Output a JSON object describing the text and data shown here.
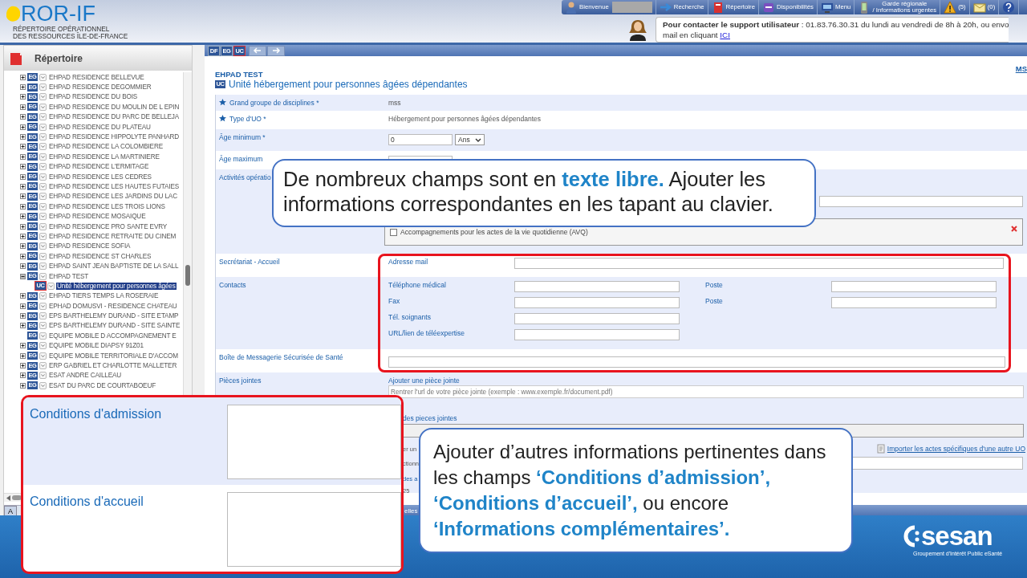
{
  "header": {
    "logo": "ROR-IF",
    "subtitle": [
      "RÉPERTOIRE OPÉRATIONNEL",
      "DES RESSOURCES ÎLE-DE-FRANCE"
    ]
  },
  "nav": [
    {
      "kind": "welcome",
      "lines": [
        "Bienvenue"
      ]
    },
    {
      "kind": "search",
      "lines": [
        "Recherche"
      ]
    },
    {
      "kind": "directory",
      "lines": [
        "Répertoire"
      ]
    },
    {
      "kind": "availability",
      "lines": [
        "Disponibilités"
      ]
    },
    {
      "kind": "menu",
      "lines": [
        "Menu"
      ]
    },
    {
      "kind": "guard",
      "lines": [
        "Garde régionale",
        "/ Informations urgentes"
      ]
    },
    {
      "kind": "alerts",
      "lines": [
        "(5)"
      ]
    },
    {
      "kind": "messages",
      "lines": [
        "(0)"
      ]
    },
    {
      "kind": "help"
    }
  ],
  "support": {
    "title": "Pour contacter le support utilisateur",
    "text": " : 01.83.76.30.31 du lundi au vendredi de 8h à 20h, ou envo",
    "text2": "mail en cliquant ",
    "link": "ICI"
  },
  "sidebar": {
    "title": "Répertoire",
    "tree": [
      {
        "label": "EHPAD RESIDENCE BELLEVUE",
        "badge": "EG",
        "expandable": true,
        "expanded": false,
        "selected": false
      },
      {
        "label": "EHPAD RESIDENCE DEGOMMIER",
        "badge": "EG",
        "expandable": true,
        "expanded": false,
        "selected": false
      },
      {
        "label": "EHPAD RESIDENCE DU BOIS",
        "badge": "EG",
        "expandable": true,
        "expanded": false,
        "selected": false
      },
      {
        "label": "EHPAD RESIDENCE DU MOULIN DE L EPIN",
        "badge": "EG",
        "expandable": true,
        "expanded": false,
        "selected": false
      },
      {
        "label": "EHPAD RESIDENCE DU PARC DE BELLEJA",
        "badge": "EG",
        "expandable": true,
        "expanded": false,
        "selected": false
      },
      {
        "label": "EHPAD RESIDENCE DU PLATEAU",
        "badge": "EG",
        "expandable": true,
        "expanded": false,
        "selected": false
      },
      {
        "label": "EHPAD RESIDENCE HIPPOLYTE PANHARD",
        "badge": "EG",
        "expandable": true,
        "expanded": false,
        "selected": false
      },
      {
        "label": "EHPAD RESIDENCE LA COLOMBIERE",
        "badge": "EG",
        "expandable": true,
        "expanded": false,
        "selected": false
      },
      {
        "label": "EHPAD RESIDENCE LA MARTINIERE",
        "badge": "EG",
        "expandable": true,
        "expanded": false,
        "selected": false
      },
      {
        "label": "EHPAD RESIDENCE L'ERMITAGE",
        "badge": "EG",
        "expandable": true,
        "expanded": false,
        "selected": false
      },
      {
        "label": "EHPAD RESIDENCE LES CEDRES",
        "badge": "EG",
        "expandable": true,
        "expanded": false,
        "selected": false
      },
      {
        "label": "EHPAD RESIDENCE LES HAUTES FUTAIES",
        "badge": "EG",
        "expandable": true,
        "expanded": false,
        "selected": false
      },
      {
        "label": "EHPAD RESIDENCE LES JARDINS DU LAC",
        "badge": "EG",
        "expandable": true,
        "expanded": false,
        "selected": false
      },
      {
        "label": "EHPAD RESIDENCE LES TROIS LIONS",
        "badge": "EG",
        "expandable": true,
        "expanded": false,
        "selected": false
      },
      {
        "label": "EHPAD RESIDENCE MOSAIQUE",
        "badge": "EG",
        "expandable": true,
        "expanded": false,
        "selected": false
      },
      {
        "label": "EHPAD RESIDENCE PRO SANTE EVRY",
        "badge": "EG",
        "expandable": true,
        "expanded": false,
        "selected": false
      },
      {
        "label": "EHPAD RESIDENCE RETRAITE DU CINEM",
        "badge": "EG",
        "expandable": true,
        "expanded": false,
        "selected": false
      },
      {
        "label": "EHPAD RESIDENCE SOFIA",
        "badge": "EG",
        "expandable": true,
        "expanded": false,
        "selected": false
      },
      {
        "label": "EHPAD RESIDENCE ST CHARLES",
        "badge": "EG",
        "expandable": true,
        "expanded": false,
        "selected": false
      },
      {
        "label": "EHPAD SAINT JEAN BAPTISTE DE LA SALL",
        "badge": "EG",
        "expandable": true,
        "expanded": false,
        "selected": false
      },
      {
        "label": "EHPAD TEST",
        "badge": "EG",
        "expandable": true,
        "expanded": true,
        "selected": false,
        "children": [
          {
            "label": "Unité hébergement pour personnes âgées",
            "badge": "UC",
            "expandable": false,
            "selected": true
          }
        ]
      },
      {
        "label": "EHPAD TIERS TEMPS LA ROSERAIE",
        "badge": "EG",
        "expandable": true,
        "expanded": false,
        "selected": false
      },
      {
        "label": "EPHAD DOMUSVI - RESIDENCE CHATEAU",
        "badge": "EG",
        "expandable": true,
        "expanded": false,
        "selected": false
      },
      {
        "label": "EPS BARTHELEMY DURAND - SITE ETAMP",
        "badge": "EG",
        "expandable": true,
        "expanded": false,
        "selected": false
      },
      {
        "label": "EPS BARTHELEMY DURAND - SITE SAINTE",
        "badge": "EG",
        "expandable": true,
        "expanded": false,
        "selected": false
      },
      {
        "label": "EQUIPE MOBILE D ACCOMPAGNEMENT E",
        "badge": "EG",
        "expandable": false,
        "selected": false
      },
      {
        "label": "EQUIPE MOBILE DIAPSY 91Z01",
        "badge": "EG",
        "expandable": true,
        "expanded": false,
        "selected": false
      },
      {
        "label": "EQUIPE MOBILE TERRITORIALE D'ACCOM",
        "badge": "EG",
        "expandable": true,
        "expanded": false,
        "selected": false
      },
      {
        "label": "ERP GABRIEL ET CHARLOTTE MALLETER",
        "badge": "EG",
        "expandable": true,
        "expanded": false,
        "selected": false
      },
      {
        "label": "ESAT ANDRE CAILLEAU",
        "badge": "EG",
        "expandable": true,
        "expanded": false,
        "selected": false
      },
      {
        "label": "ESAT DU PARC DE COURTABOEUF",
        "badge": "EG",
        "expandable": true,
        "expanded": false,
        "selected": false
      }
    ],
    "bottom_tab": "A"
  },
  "toolbar": {
    "buttons": [
      {
        "label": "DF",
        "selected": false
      },
      {
        "label": "EG",
        "selected": false
      },
      {
        "label": "UC",
        "selected": true
      }
    ]
  },
  "content": {
    "org": "EHPAD TEST",
    "badge": "UC",
    "unit": "Unité hébergement pour personnes âgées dépendantes",
    "corner_link": "MS",
    "rows": [
      {
        "kind": "text",
        "label": "Grand groupe de disciplines *",
        "starred": true,
        "value": "mss"
      },
      {
        "kind": "text",
        "label": "Type d'UO *",
        "starred": true,
        "value": "Hébergement pour personnes âgées dépendantes"
      },
      {
        "kind": "age",
        "label": "Âge minimum *",
        "starred": false,
        "value": "0",
        "unit": "Ans"
      },
      {
        "kind": "age",
        "label": "Âge maximum",
        "starred": false
      },
      {
        "kind": "activities",
        "label": "Activités opératio",
        "starred": false,
        "option": "Accompagnements pour les actes de la vie quotidienne (AVQ)",
        "checked": false
      },
      {
        "kind": "fields",
        "label": "Secrétariat - Accueil",
        "starred": false,
        "fields": [
          {
            "label": "Adresse mail",
            "wide": true
          }
        ]
      },
      {
        "kind": "fields",
        "label": "Contacts",
        "starred": false,
        "fields": [
          {
            "label": "Téléphone médical",
            "wide": false,
            "extra": "Poste"
          },
          {
            "label": "Fax",
            "wide": false,
            "extra": "Poste"
          },
          {
            "label": "Tél. soignants",
            "wide": false
          },
          {
            "label": "URL/lien de téléexpertise",
            "wide": false
          }
        ]
      },
      {
        "kind": "wide",
        "label": "Boîte de Messagerie Sécurisée de Santé",
        "starred": false
      },
      {
        "kind": "attachments",
        "label": "Pièces jointes",
        "starred": false,
        "add": "Ajouter une pièce jointe",
        "placeholder": "Rentrer l'url de votre pièce jointe (exemple : www.exemple.fr/document.pdf)",
        "list_label": "des pieces jointes",
        "fragments": [
          "er un",
          "ctionn",
          "des a",
          "25"
        ],
        "import_link": "Importer les actes spécifiques d'une autre UO"
      }
    ],
    "bottom_tab": "elles"
  },
  "callouts": [
    {
      "text": "De nombreux champs sont en **texte libre.** Ajouter les informations correspondantes en les tapant au clavier."
    },
    {
      "text": "Ajouter d’autres informations pertinentes dans les champs **‘Conditions d’admission’,** **‘Conditions d’accueil’,** ou encore **‘Informations complémentaires’.**"
    }
  ],
  "inset": {
    "fields": [
      {
        "label": "Conditions d'admission"
      },
      {
        "label": "Conditions d'accueil"
      }
    ]
  },
  "footer": {
    "brand": "sesan",
    "tagline": "Groupement d'Intérêt Public eSanté"
  }
}
